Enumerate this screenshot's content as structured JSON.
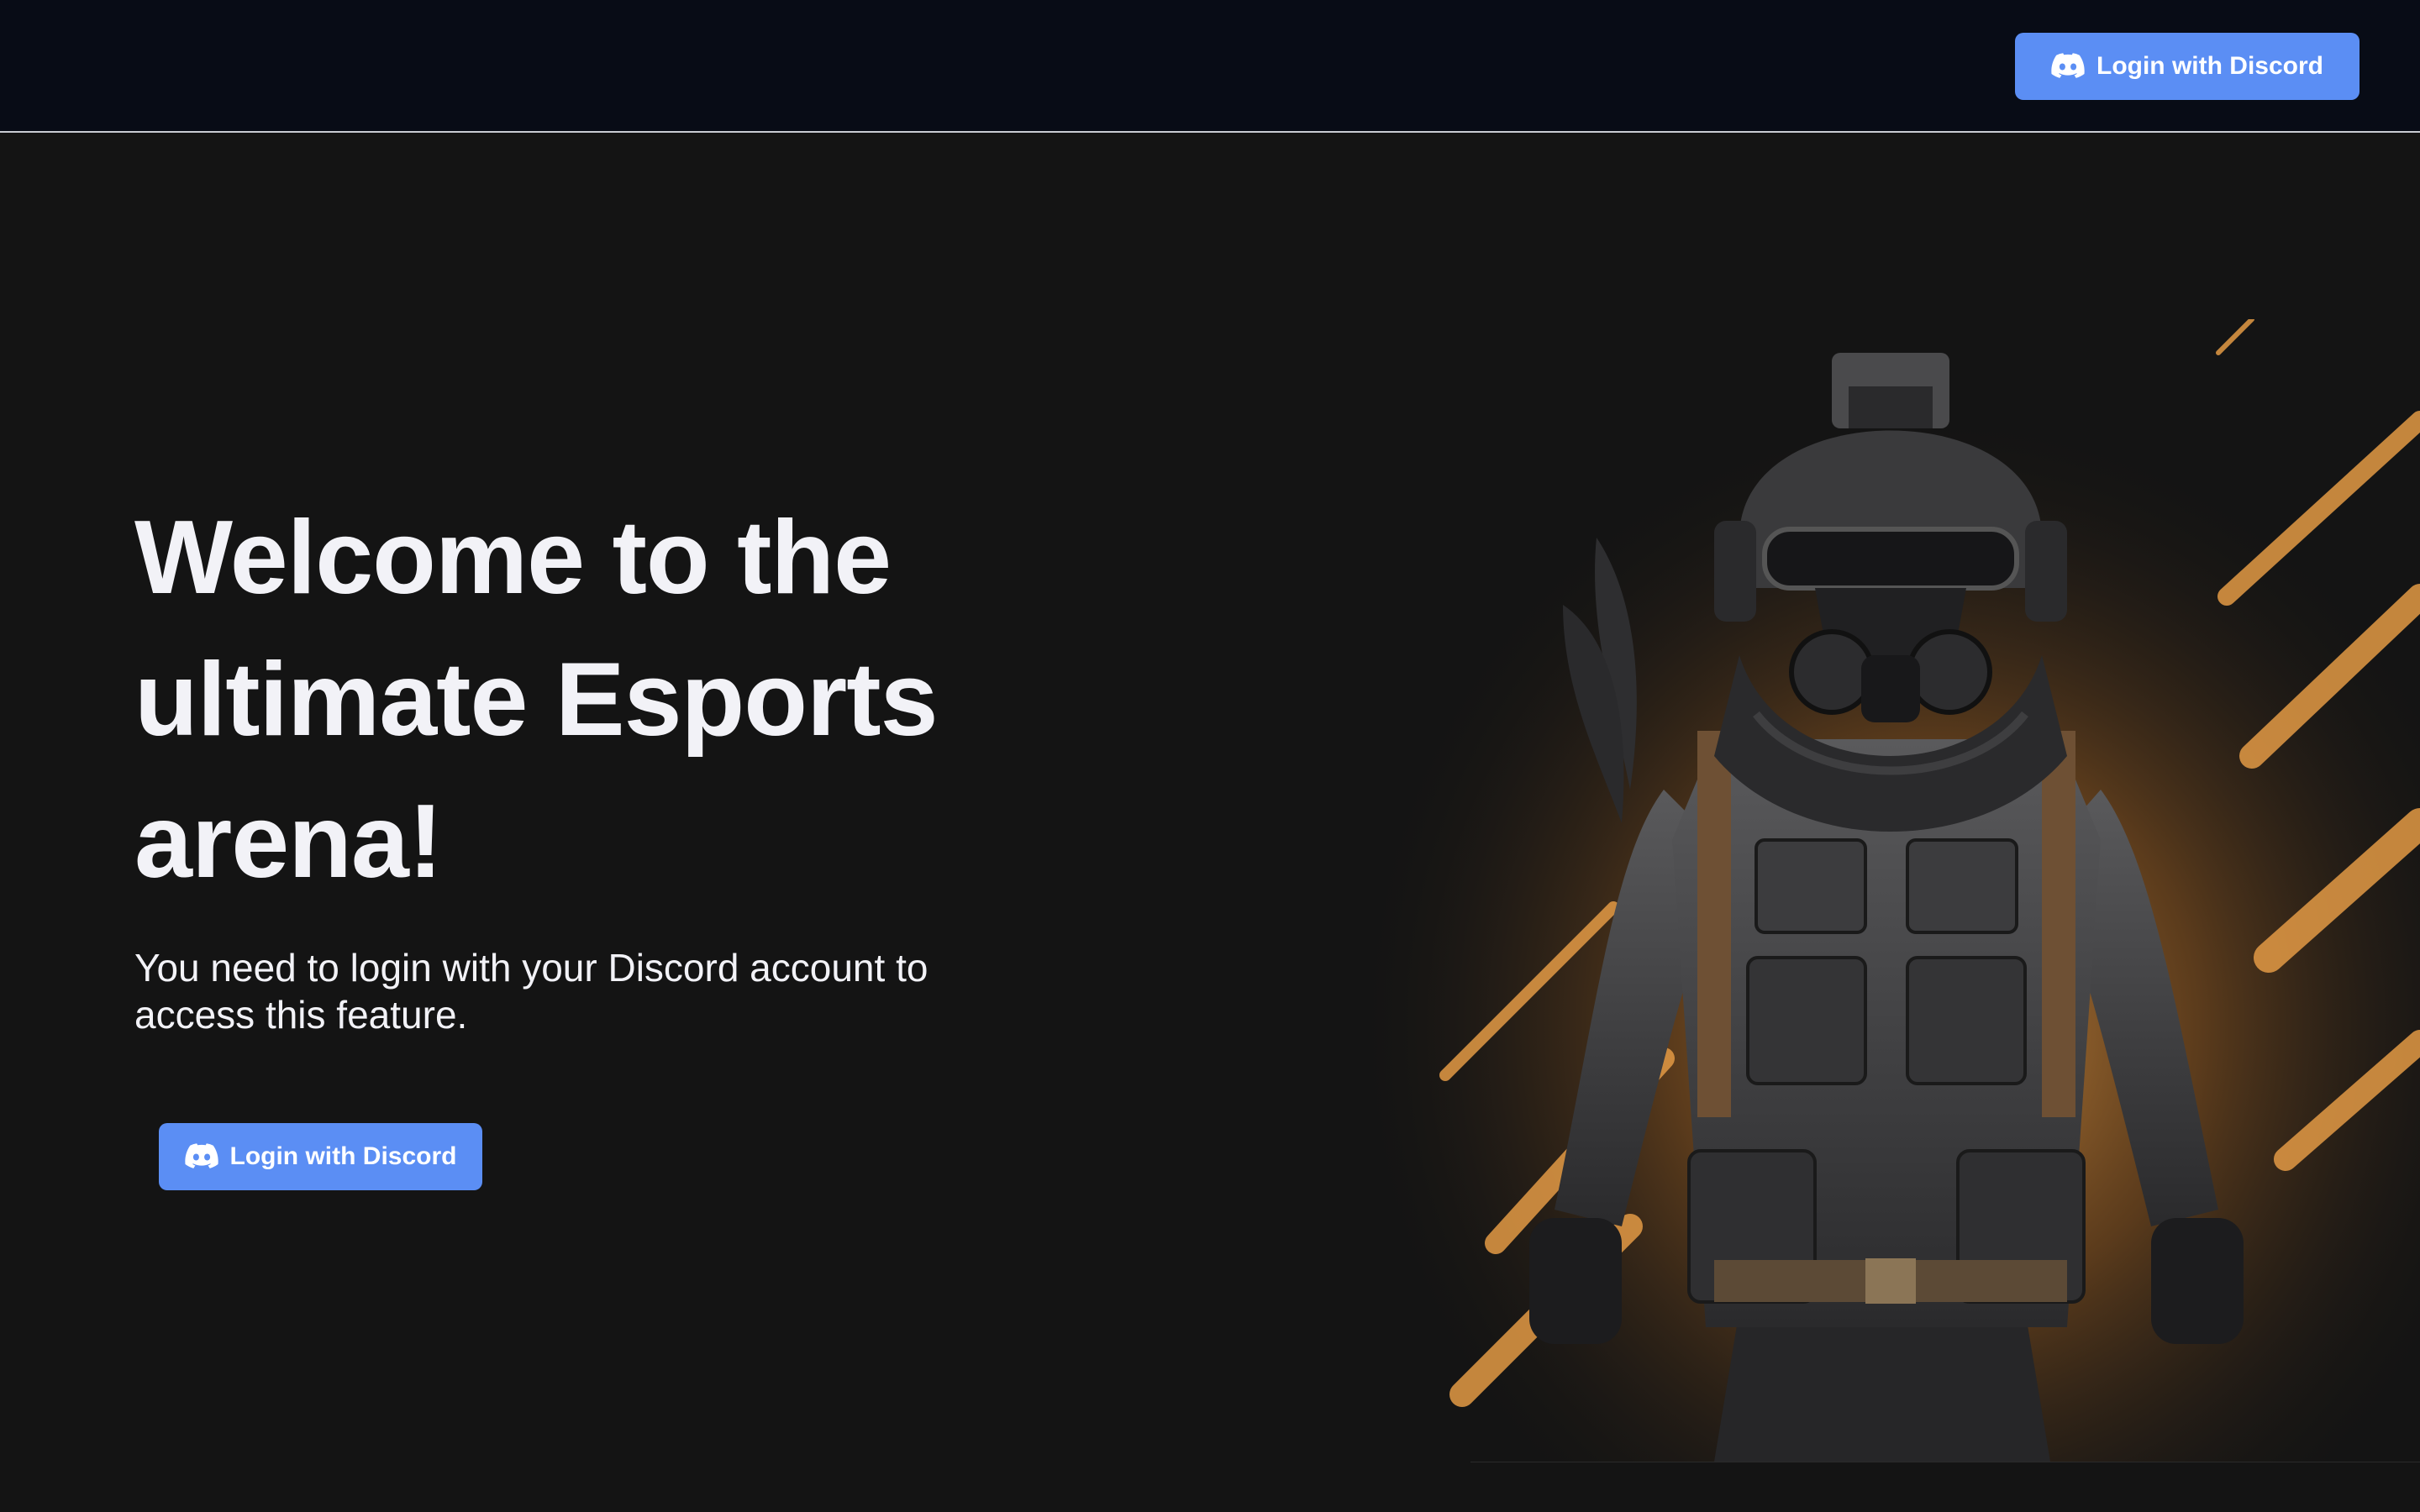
{
  "header": {
    "login_button_label": "Login with Discord",
    "login_icon": "discord-icon"
  },
  "hero": {
    "title": "Welcome to the ultimate Esports arena!",
    "subtitle": "You need to login with your Discord account to access this feature.",
    "login_button_label": "Login with Discord",
    "login_icon": "discord-icon",
    "illustration": "soldier-with-gas-mask-illustration"
  },
  "colors": {
    "accent": "#5b8ef4",
    "background": "#141414",
    "header_background": "#080c16",
    "text": "#f2f2f7",
    "art_orange": "#e8a04a"
  }
}
